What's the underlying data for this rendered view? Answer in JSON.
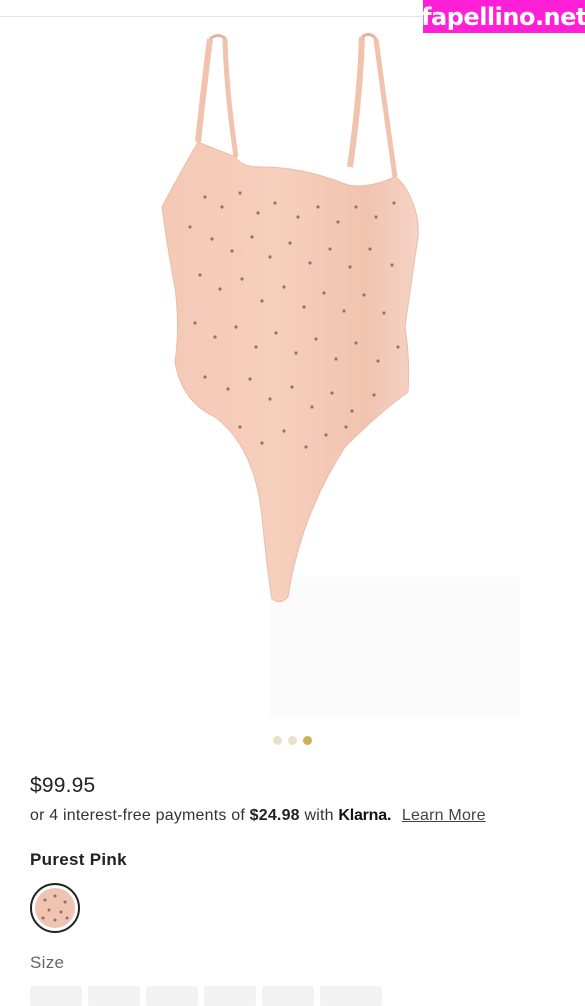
{
  "watermark": "fapellino.net",
  "product": {
    "price": "$99.95",
    "installments": {
      "prefix": "or 4 interest-free payments of",
      "amount": "$24.98",
      "with": "with",
      "provider": "Klarna.",
      "link": "Learn More"
    },
    "color_name": "Purest Pink",
    "swatch_color": "#f0c3b3",
    "size_label": "Size"
  },
  "carousel": {
    "count": 3,
    "active_index": 2
  },
  "colors": {
    "accent_dot": "#c9b05a",
    "inactive_dot": "#e7e2c9",
    "watermark_bg": "#ff1fd6"
  }
}
